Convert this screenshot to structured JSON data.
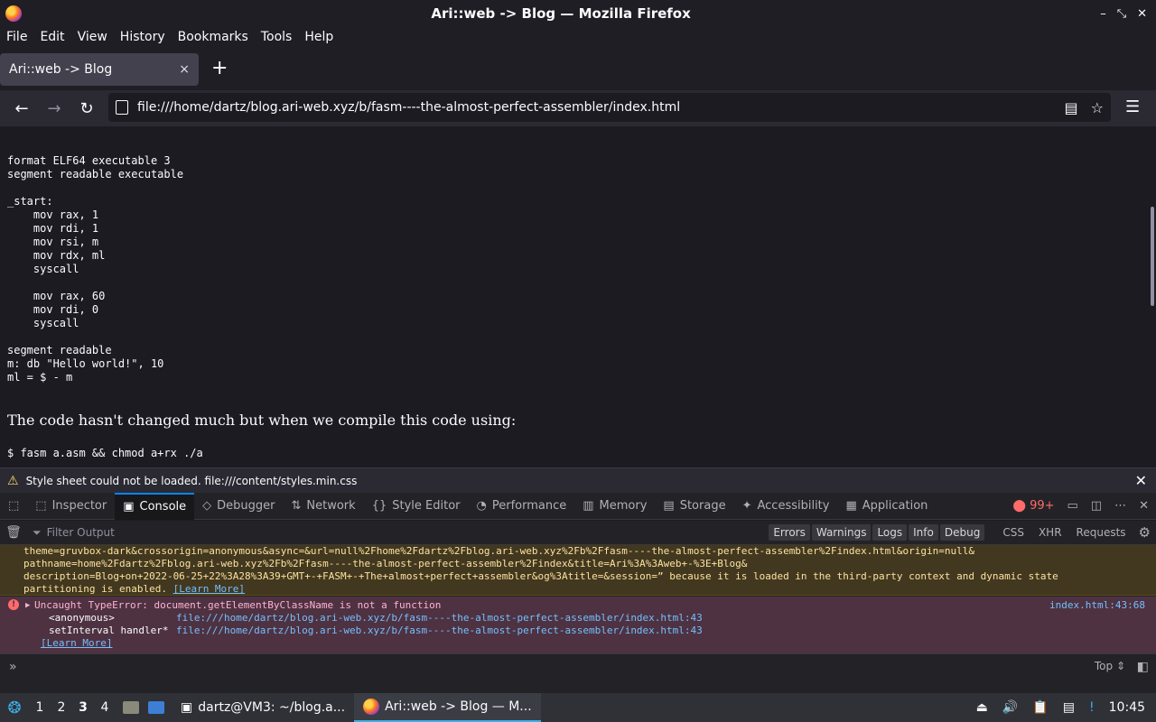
{
  "window": {
    "title": "Ari::web -> Blog — Mozilla Firefox",
    "controls": [
      "–",
      "⤡",
      "✕"
    ]
  },
  "menu": [
    "File",
    "Edit",
    "View",
    "History",
    "Bookmarks",
    "Tools",
    "Help"
  ],
  "tab": {
    "label": "Ari::web -> Blog",
    "close": "×",
    "new": "+"
  },
  "nav": {
    "back": "←",
    "forward": "→",
    "reload": "↻",
    "url": "file:///home/dartz/blog.ari-web.xyz/b/fasm----the-almost-perfect-assembler/index.html",
    "reader": "▤",
    "bookmark": "☆",
    "menu": "☰"
  },
  "page": {
    "code_lines": [
      "format ELF64 executable 3",
      "segment readable executable",
      "",
      "_start:",
      "    mov rax, 1",
      "    mov rdi, 1",
      "    mov rsi, m",
      "    mov rdx, ml",
      "    syscall",
      "",
      "    mov rax, 60",
      "    mov rdi, 0",
      "    syscall",
      "",
      "segment readable",
      "m: db \"Hello world!\", 10",
      "ml = $ - m"
    ],
    "paragraph": "The code hasn't changed much but when we compile this code using:",
    "command": "$ fasm a.asm && chmod a+rx ./a"
  },
  "notification": {
    "message": "Style sheet could not be loaded. file:///content/styles.min.css",
    "close": "✕"
  },
  "devtools": {
    "tabs": [
      {
        "label": "Inspector",
        "icon": "⬚"
      },
      {
        "label": "Console",
        "icon": "▣"
      },
      {
        "label": "Debugger",
        "icon": "◇"
      },
      {
        "label": "Network",
        "icon": "⇅"
      },
      {
        "label": "Style Editor",
        "icon": "{}"
      },
      {
        "label": "Performance",
        "icon": "◔"
      },
      {
        "label": "Memory",
        "icon": "▥"
      },
      {
        "label": "Storage",
        "icon": "▤"
      },
      {
        "label": "Accessibility",
        "icon": "✦"
      },
      {
        "label": "Application",
        "icon": "▦"
      }
    ],
    "error_count": "99+",
    "filter_placeholder": "Filter Output",
    "levels": [
      "Errors",
      "Warnings",
      "Logs",
      "Info",
      "Debug"
    ],
    "requests": [
      "CSS",
      "XHR",
      "Requests"
    ],
    "warning": {
      "line1": "theme=gruvbox-dark&crossorigin=anonymous&async=&url=null%2Fhome%2Fdartz%2Fblog.ari-web.xyz%2Fb%2Ffasm----the-almost-perfect-assembler%2Findex.html&origin=null&",
      "line2": "pathname=home%2Fdartz%2Fblog.ari-web.xyz%2Fb%2Ffasm----the-almost-perfect-assembler%2Findex&title=Ari%3A%3Aweb+-%3E+Blog&",
      "line3": "description=Blog+on+2022-06-25+22%3A28%3A39+GMT+-+FASM+-+The+almost+perfect+assembler&og%3Atitle=&session=” because it is loaded in the third-party context and dynamic state",
      "line4": "partitioning is enabled. ",
      "learn_more": "[Learn More]"
    },
    "error": {
      "message": "Uncaught TypeError: document.getElementByClassName is not a function",
      "location": "index.html:43:68",
      "frame1_name": "<anonymous>",
      "frame1_url": "file:///home/dartz/blog.ari-web.xyz/b/fasm----the-almost-perfect-assembler/index.html:43",
      "frame2_name": "setInterval handler*",
      "frame2_url": "file:///home/dartz/blog.ari-web.xyz/b/fasm----the-almost-perfect-assembler/index.html:43",
      "learn_more": "[Learn More]"
    },
    "prompt": "»",
    "context": "Top ⇕"
  },
  "taskbar": {
    "workspaces": [
      "1",
      "2",
      "3",
      "4"
    ],
    "apps": [
      {
        "label": "dartz@VM3: ~/blog.a..."
      },
      {
        "label": "Ari::web -> Blog — M..."
      }
    ],
    "clock": "10:45"
  }
}
